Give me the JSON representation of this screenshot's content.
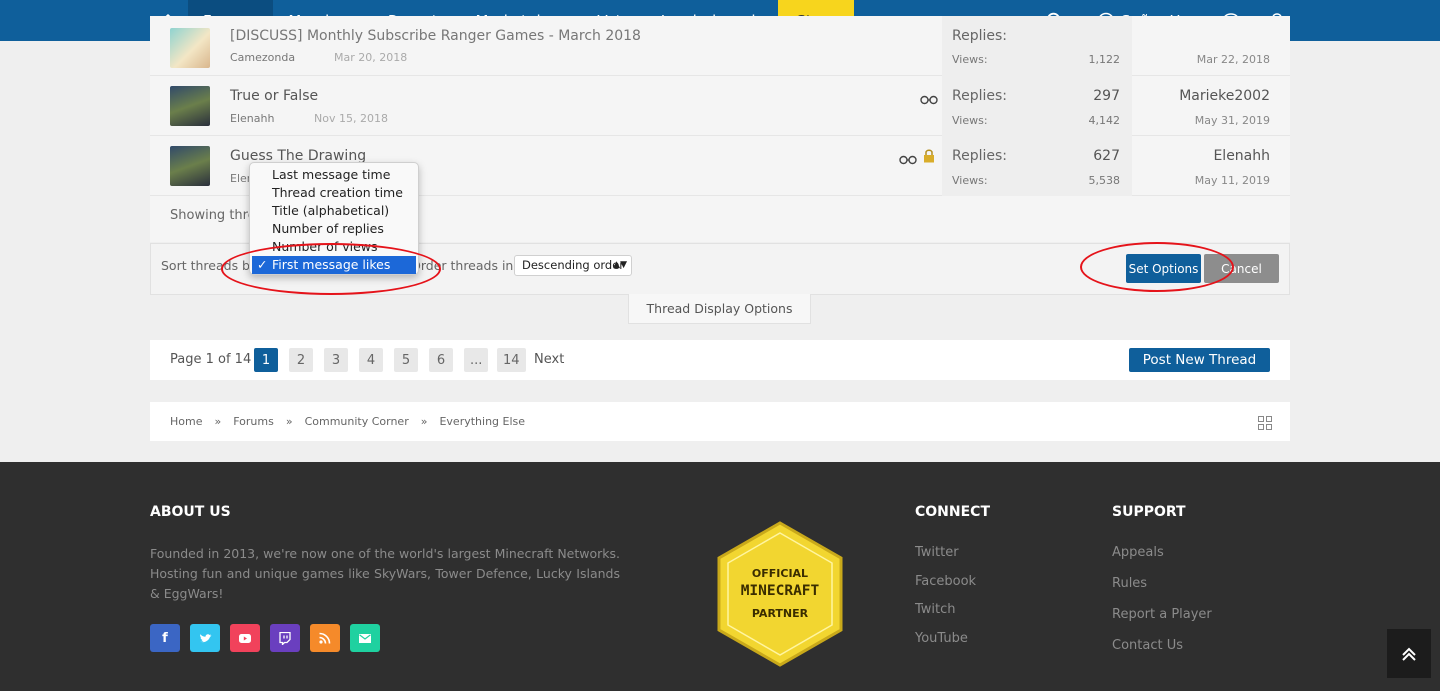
{
  "nav": {
    "items": [
      "Forums",
      "Members",
      "Reports",
      "Marketplace",
      "Vote",
      "Leaderboards",
      "Store"
    ],
    "user": "Señor Ho...",
    "colors": {
      "bar": "#0f5f9b",
      "store": "#f7d51d"
    }
  },
  "threads": [
    {
      "title": "[DISCUSS] Monthly Subscribe Ranger Games - March 2018",
      "author": "Camezonda",
      "date": "Mar 20, 2018",
      "replies_label": "Replies:",
      "replies": "",
      "views_label": "Views:",
      "views": "1,122",
      "last_user": "",
      "last_date": "Mar 22, 2018"
    },
    {
      "title": "True or False",
      "author": "Elenahh",
      "date": "Nov 15, 2018",
      "replies_label": "Replies:",
      "replies": "297",
      "views_label": "Views:",
      "views": "4,142",
      "last_user": "Marieke2002",
      "last_date": "May 31, 2019"
    },
    {
      "title": "Guess The Drawing",
      "author": "Elenahh",
      "date": "",
      "replies_label": "Replies:",
      "replies": "627",
      "views_label": "Views:",
      "views": "5,538",
      "last_user": "Elenahh",
      "last_date": "May 11, 2019"
    }
  ],
  "showing": "Showing threads",
  "sort": {
    "label": "Sort threads by",
    "order_label": "Order threads in:",
    "order_value": "Descending order",
    "options": [
      "Last message time",
      "Thread creation time",
      "Title (alphabetical)",
      "Number of replies",
      "Number of views",
      "First message likes"
    ],
    "selected": "First message likes",
    "set_button": "Set Options",
    "cancel_button": "Cancel"
  },
  "display_options_tab": "Thread Display Options",
  "pagination": {
    "label": "Page 1 of 14",
    "pages": [
      "1",
      "2",
      "3",
      "4",
      "5",
      "6",
      "...",
      "14"
    ],
    "current": "1",
    "next": "Next"
  },
  "post_new_thread": "Post New Thread",
  "breadcrumb": [
    "Home",
    "Forums",
    "Community Corner",
    "Everything Else"
  ],
  "footer": {
    "about_title": "ABOUT US",
    "about_text": "Founded in 2013, we're now one of the world's largest Minecraft Networks. Hosting fun and unique games like SkyWars, Tower Defence, Lucky Islands & EggWars!",
    "badge": [
      "OFFICIAL",
      "MINECRAFT",
      "PARTNER"
    ],
    "connect_title": "CONNECT",
    "connect_links": [
      "Twitter",
      "Facebook",
      "Twitch",
      "YouTube"
    ],
    "support_title": "SUPPORT",
    "support_links": [
      "Appeals",
      "Rules",
      "Report a Player",
      "Contact Us"
    ],
    "social": [
      {
        "icon": "facebook-icon",
        "color": "#3b66c4"
      },
      {
        "icon": "twitter-icon",
        "color": "#33c5f0"
      },
      {
        "icon": "youtube-icon",
        "color": "#f1425b"
      },
      {
        "icon": "twitch-icon",
        "color": "#6a3fbf"
      },
      {
        "icon": "rss-icon",
        "color": "#f58a2a"
      },
      {
        "icon": "mail-icon",
        "color": "#1fd1a0"
      }
    ]
  }
}
